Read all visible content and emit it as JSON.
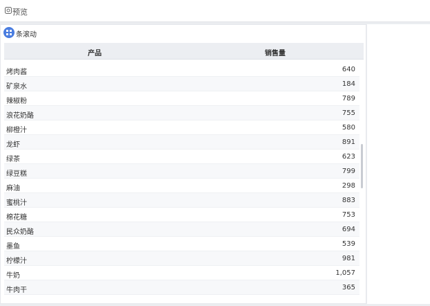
{
  "toolbar": {
    "preview_label": "预览",
    "preview_icon": "preview-icon"
  },
  "widget": {
    "title": "条滚动",
    "icon": "grid-icon",
    "accent": "#4a7de0"
  },
  "table": {
    "columns": [
      "产品",
      "销售量"
    ],
    "rows": [
      {
        "product": "烤肉酱",
        "sales": "640"
      },
      {
        "product": "矿泉水",
        "sales": "184"
      },
      {
        "product": "辣椒粉",
        "sales": "789"
      },
      {
        "product": "浪花奶酪",
        "sales": "755"
      },
      {
        "product": "柳橙汁",
        "sales": "580"
      },
      {
        "product": "龙虾",
        "sales": "891"
      },
      {
        "product": "绿茶",
        "sales": "623"
      },
      {
        "product": "绿豆糕",
        "sales": "799"
      },
      {
        "product": "麻油",
        "sales": "298"
      },
      {
        "product": "蜜桃汁",
        "sales": "883"
      },
      {
        "product": "棉花糖",
        "sales": "753"
      },
      {
        "product": "民众奶酪",
        "sales": "694"
      },
      {
        "product": "墨鱼",
        "sales": "539"
      },
      {
        "product": "柠檬汁",
        "sales": "981"
      },
      {
        "product": "牛奶",
        "sales": "1,057"
      },
      {
        "product": "牛肉干",
        "sales": "365"
      }
    ]
  }
}
